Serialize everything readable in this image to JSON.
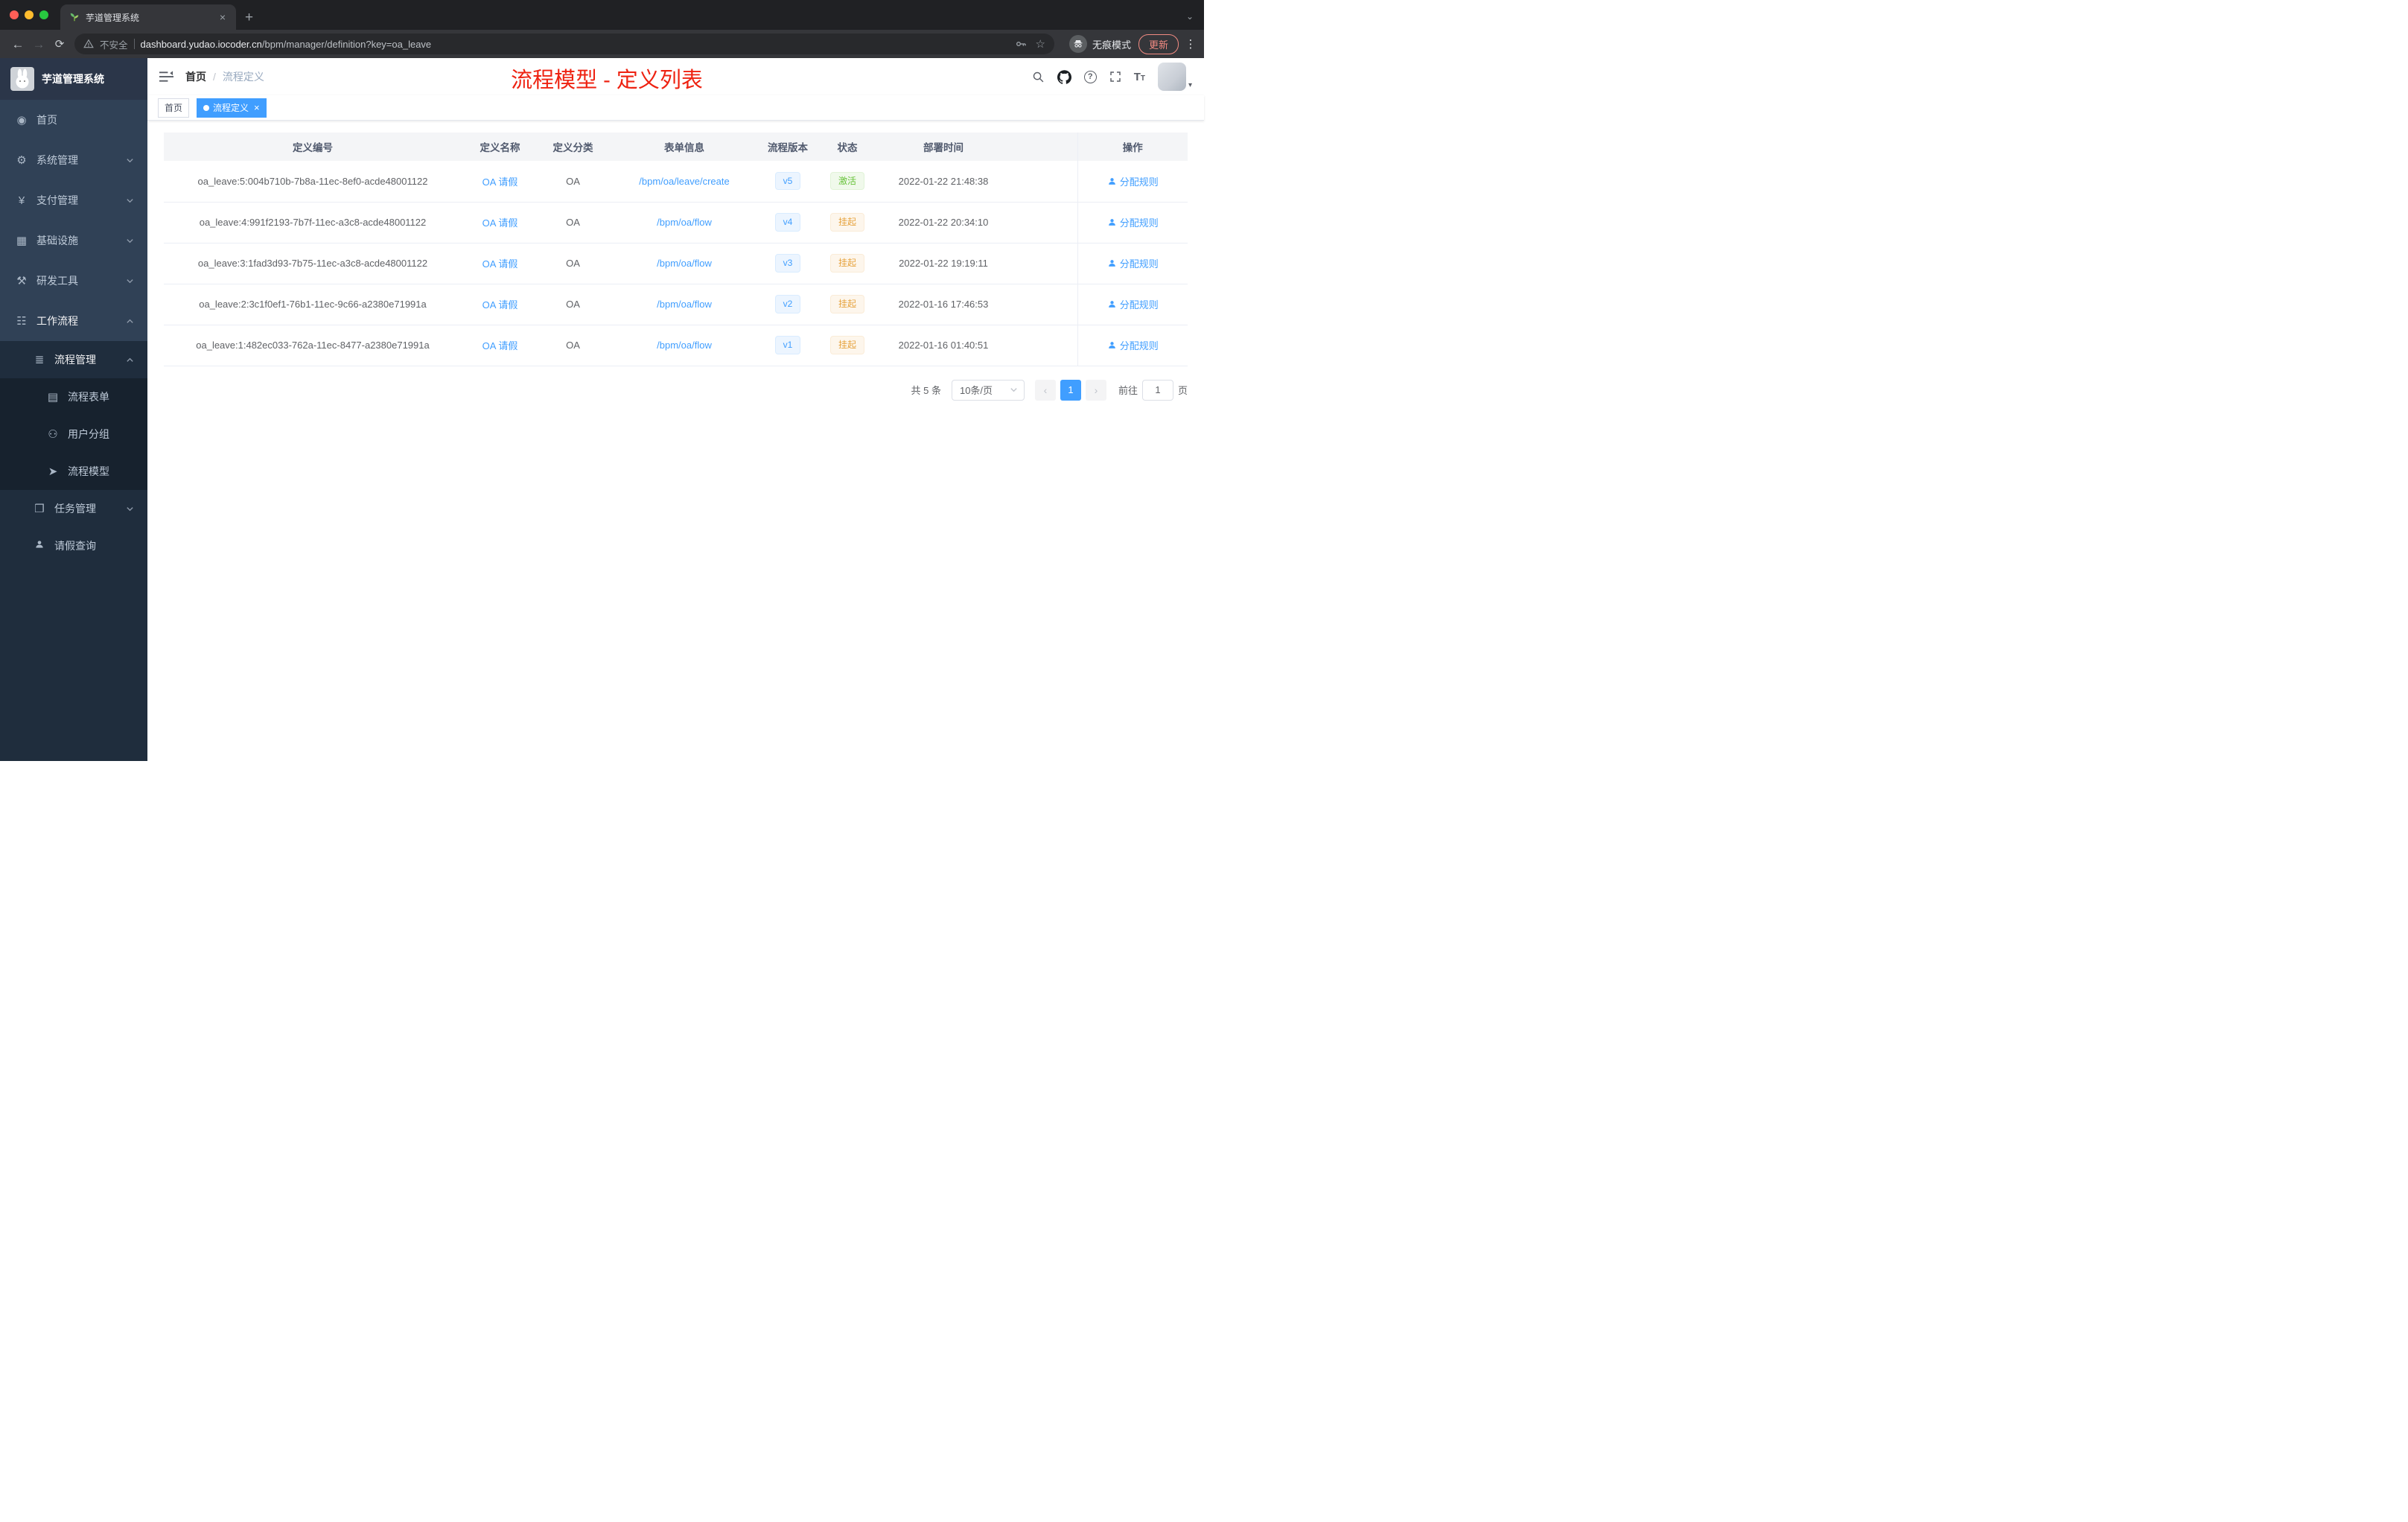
{
  "colors": {
    "accent": "#409eff",
    "success_status": "#67c23a",
    "warning_status": "#e6a23c",
    "annotation_red": "#ee2211",
    "sidebar_bg": "#304156",
    "active_tag_bg": "#409eff"
  },
  "browser": {
    "tab_title": "芋道管理系统",
    "security_label": "不安全",
    "url_domain": "dashboard.yudao.iocoder.cn",
    "url_path": "/bpm/manager/definition?key=oa_leave",
    "incognito_label": "无痕模式",
    "update_label": "更新"
  },
  "sidebar": {
    "logo_title": "芋道管理系统",
    "items": [
      {
        "label": "首页"
      },
      {
        "label": "系统管理"
      },
      {
        "label": "支付管理"
      },
      {
        "label": "基础设施"
      },
      {
        "label": "研发工具"
      },
      {
        "label": "工作流程"
      },
      {
        "label": "流程管理"
      },
      {
        "label": "流程表单"
      },
      {
        "label": "用户分组"
      },
      {
        "label": "流程模型"
      },
      {
        "label": "任务管理"
      },
      {
        "label": "请假查询"
      }
    ]
  },
  "header": {
    "breadcrumb": {
      "home": "首页",
      "separator": "/",
      "current": "流程定义"
    },
    "annotation": "流程模型 - 定义列表"
  },
  "tags": {
    "home": "首页",
    "active": "流程定义",
    "close": "×"
  },
  "table": {
    "columns": [
      "定义编号",
      "定义名称",
      "定义分类",
      "表单信息",
      "流程版本",
      "状态",
      "部署时间",
      "操作"
    ],
    "rows": [
      {
        "id": "oa_leave:5:004b710b-7b8a-11ec-8ef0-acde48001122",
        "name": "OA 请假",
        "category": "OA",
        "form": "/bpm/oa/leave/create",
        "version": "v5",
        "status": "激活",
        "time": "2022-01-22 21:48:38",
        "action": "分配规则"
      },
      {
        "id": "oa_leave:4:991f2193-7b7f-11ec-a3c8-acde48001122",
        "name": "OA 请假",
        "category": "OA",
        "form": "/bpm/oa/flow",
        "version": "v4",
        "status": "挂起",
        "time": "2022-01-22 20:34:10",
        "action": "分配规则"
      },
      {
        "id": "oa_leave:3:1fad3d93-7b75-11ec-a3c8-acde48001122",
        "name": "OA 请假",
        "category": "OA",
        "form": "/bpm/oa/flow",
        "version": "v3",
        "status": "挂起",
        "time": "2022-01-22 19:19:11",
        "action": "分配规则"
      },
      {
        "id": "oa_leave:2:3c1f0ef1-76b1-11ec-9c66-a2380e71991a",
        "name": "OA 请假",
        "category": "OA",
        "form": "/bpm/oa/flow",
        "version": "v2",
        "status": "挂起",
        "time": "2022-01-16 17:46:53",
        "action": "分配规则"
      },
      {
        "id": "oa_leave:1:482ec033-762a-11ec-8477-a2380e71991a",
        "name": "OA 请假",
        "category": "OA",
        "form": "/bpm/oa/flow",
        "version": "v1",
        "status": "挂起",
        "time": "2022-01-16 01:40:51",
        "action": "分配规则"
      }
    ]
  },
  "pagination": {
    "total": "共 5 条",
    "page_size": "10条/页",
    "prev": "‹",
    "current_page": "1",
    "next": "›",
    "goto_label": "前往",
    "goto_value": "1",
    "page_unit": "页"
  }
}
